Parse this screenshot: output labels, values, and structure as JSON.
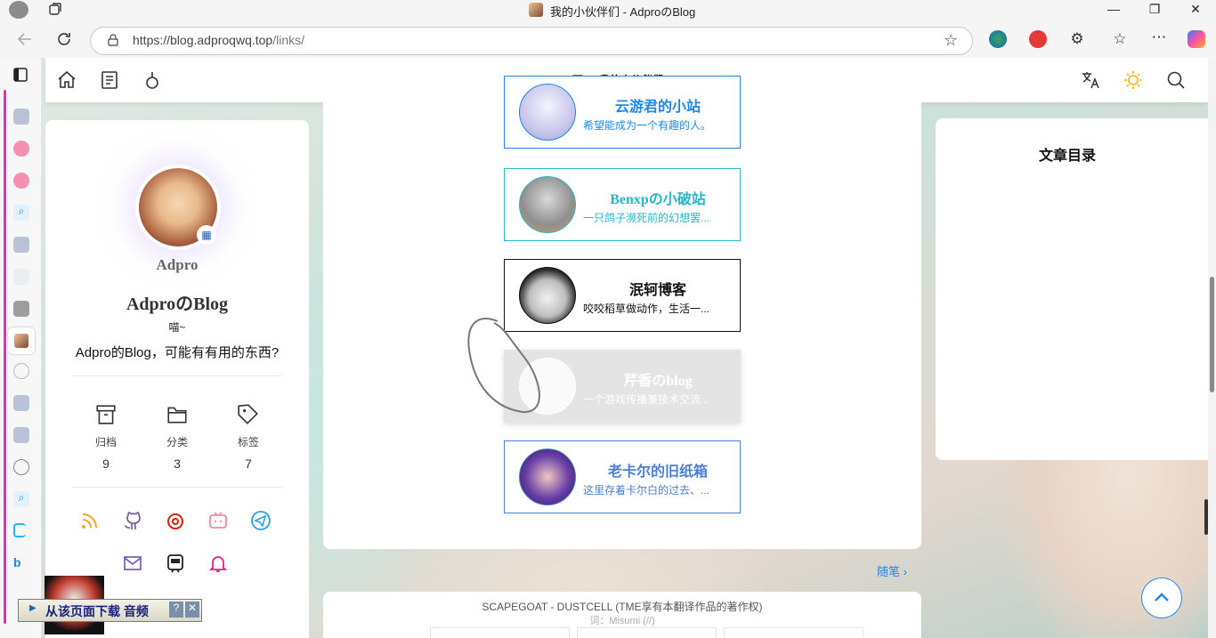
{
  "browser": {
    "window_title": "我的小伙伴们 - AdproのBlog",
    "url_host": "https://blog.adproqwq.top",
    "url_path": "/links/",
    "controls": {
      "minimize": "—",
      "restore": "❐",
      "close": "✕"
    }
  },
  "topnav": {
    "page_title": "我的小伙伴们",
    "icons": [
      "home-icon",
      "article-icon",
      "anchor-icon",
      "translate-icon",
      "sun-icon",
      "search-icon"
    ]
  },
  "profile": {
    "username": "Adpro",
    "blog_name": "AdproのBlog",
    "tagline": "喵~",
    "description": "Adpro的Blog，可能有有用的东西?",
    "stats": [
      {
        "label": "归档",
        "value": "9"
      },
      {
        "label": "分类",
        "value": "3"
      },
      {
        "label": "标签",
        "value": "7"
      }
    ],
    "social_colors": {
      "rss": "#f5a623",
      "github": "#6e5494",
      "netease": "#d81e06",
      "bilibili": "#f08aa8",
      "telegram": "#2b9fe0",
      "mail": "#7b68b5",
      "subway": "#222222",
      "bell": "#e0218a"
    }
  },
  "friends": [
    {
      "name": "云游君的小站",
      "desc": "希望能成为一个有趣的人。",
      "color": "#1e88e5"
    },
    {
      "name": "Benxpの小破站",
      "desc": "一只鸽子濒死前的幻想罢...",
      "color": "#26b6c8"
    },
    {
      "name": "泯轲博客",
      "desc": "咬咬稻草做动作，生活一...",
      "color": "#111111"
    },
    {
      "name": "芹香のblog",
      "desc": "一个游戏传播兼技术交流...",
      "color": "#ffffff"
    },
    {
      "name": "老卡尔的旧纸箱",
      "desc": "这里存着卡尔白的过去、...",
      "color": "#4a7fd6"
    }
  ],
  "more_link": "随笔",
  "toc": {
    "title": "文章目录"
  },
  "music": {
    "title": "SCAPEGOAT - DUSTCELL (TME享有本翻译作品的著作权)",
    "lyric_credit": "词：Misumi (//)"
  },
  "download_bar": {
    "label": "从该页面下载 音频",
    "help": "?",
    "close": "✕"
  }
}
